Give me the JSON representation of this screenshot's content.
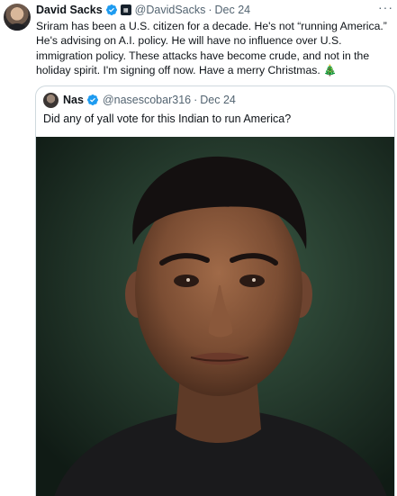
{
  "tweet": {
    "author_name": "David Sacks",
    "author_handle": "@DavidSacks",
    "separator": "·",
    "date": "Dec 24",
    "more_icon": "more-options-icon",
    "text": "Sriram has been a U.S. citizen for a decade. He's not “running America.” He's advising on A.I. policy. He will have no influence over U.S. immigration policy. These attacks have become crude, and not in the holiday spirit. I'm signing off now. Have a merry Christmas.",
    "emoji": "🎄"
  },
  "quoted_tweet": {
    "author_name": "Nas",
    "author_handle": "@nasescobar316",
    "separator": "·",
    "date": "Dec 24",
    "text": "Did any of yall vote for this Indian to run America?"
  },
  "colors": {
    "verified": "#1d9bf0",
    "secondary_text": "#536471",
    "border": "#cfd9de",
    "photo_background": "#223a2d"
  }
}
